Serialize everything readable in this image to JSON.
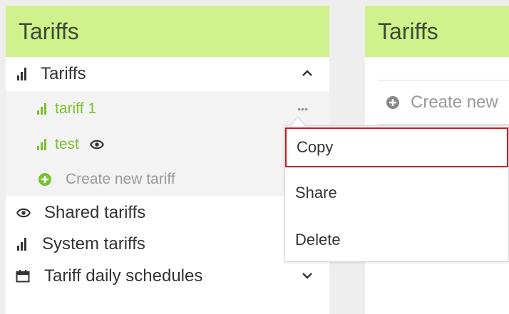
{
  "left_panel": {
    "title": "Tariffs",
    "group": {
      "label": "Tariffs",
      "expanded": true
    },
    "items": [
      {
        "label": "tariff 1"
      },
      {
        "label": "test",
        "shared": true
      }
    ],
    "create_label": "Create new tariff",
    "sections": [
      {
        "label": "Shared tariffs",
        "icon": "shared-eye-icon"
      },
      {
        "label": "System tariffs",
        "icon": "bar-chart-icon"
      },
      {
        "label": "Tariff daily schedules",
        "icon": "calendar-icon"
      }
    ],
    "more_label": "•••"
  },
  "right_panel": {
    "title": "Tariffs",
    "create_label": "Create new"
  },
  "context_menu": {
    "items": [
      {
        "label": "Copy",
        "highlighted": true
      },
      {
        "label": "Share"
      },
      {
        "label": "Delete"
      }
    ]
  },
  "colors": {
    "header_bg": "#cff28c",
    "accent_green": "#79c22d",
    "highlight_border": "#e0131b"
  }
}
